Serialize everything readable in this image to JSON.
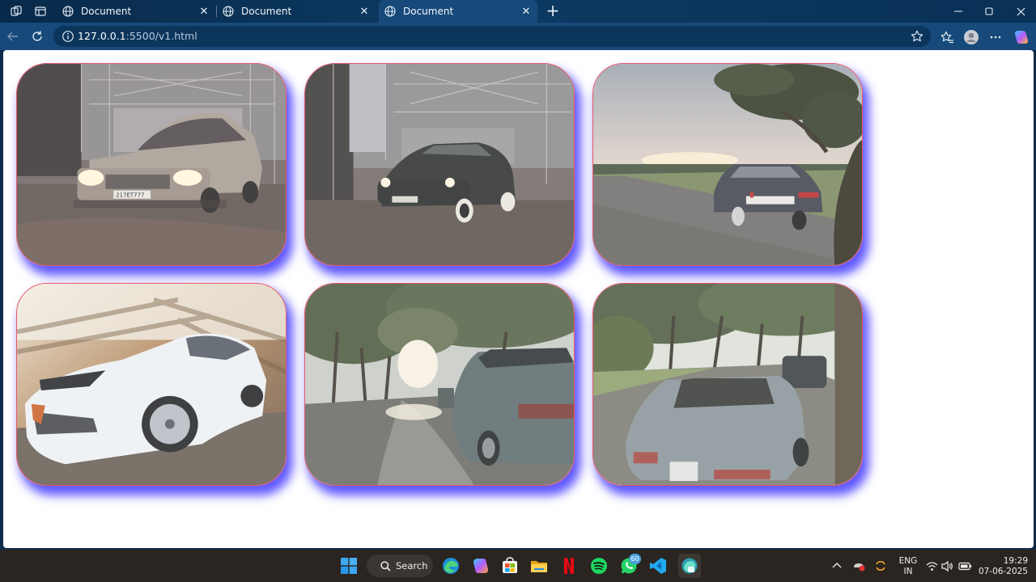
{
  "browser": {
    "tabs": [
      {
        "title": "Document",
        "active": false
      },
      {
        "title": "Document",
        "active": false
      },
      {
        "title": "Document",
        "active": true
      }
    ],
    "address": {
      "host": "127.0.0.1",
      "path": ":5500/v1.html"
    }
  },
  "page": {
    "cards": [
      {
        "scene": "garage-classic-sedan-headlights",
        "plate": "217ET777"
      },
      {
        "scene": "garage-vintage-dark-sedan",
        "plate": ""
      },
      {
        "scene": "sunset-road-mercedes",
        "plate": ""
      },
      {
        "scene": "white-camaro-motion",
        "plate": ""
      },
      {
        "scene": "tree-lined-street-parked-car",
        "plate": ""
      },
      {
        "scene": "street-old-mercedes-trees",
        "plate": ""
      }
    ],
    "colors": {
      "card_border": "#e5586a",
      "card_glow": "#4638ff"
    }
  },
  "taskbar": {
    "search_label": "Search",
    "whatsapp_badge": "60",
    "language": "ENG",
    "region": "IN",
    "time": "19:29",
    "date": "07-06-2025",
    "apps": [
      "start-icon",
      "search-icon",
      "edge-icon",
      "copilot-icon",
      "store-icon",
      "file-explorer-icon",
      "netflix-icon",
      "spotify-icon",
      "whatsapp-icon",
      "vscode-icon",
      "edge-dev-icon"
    ]
  }
}
